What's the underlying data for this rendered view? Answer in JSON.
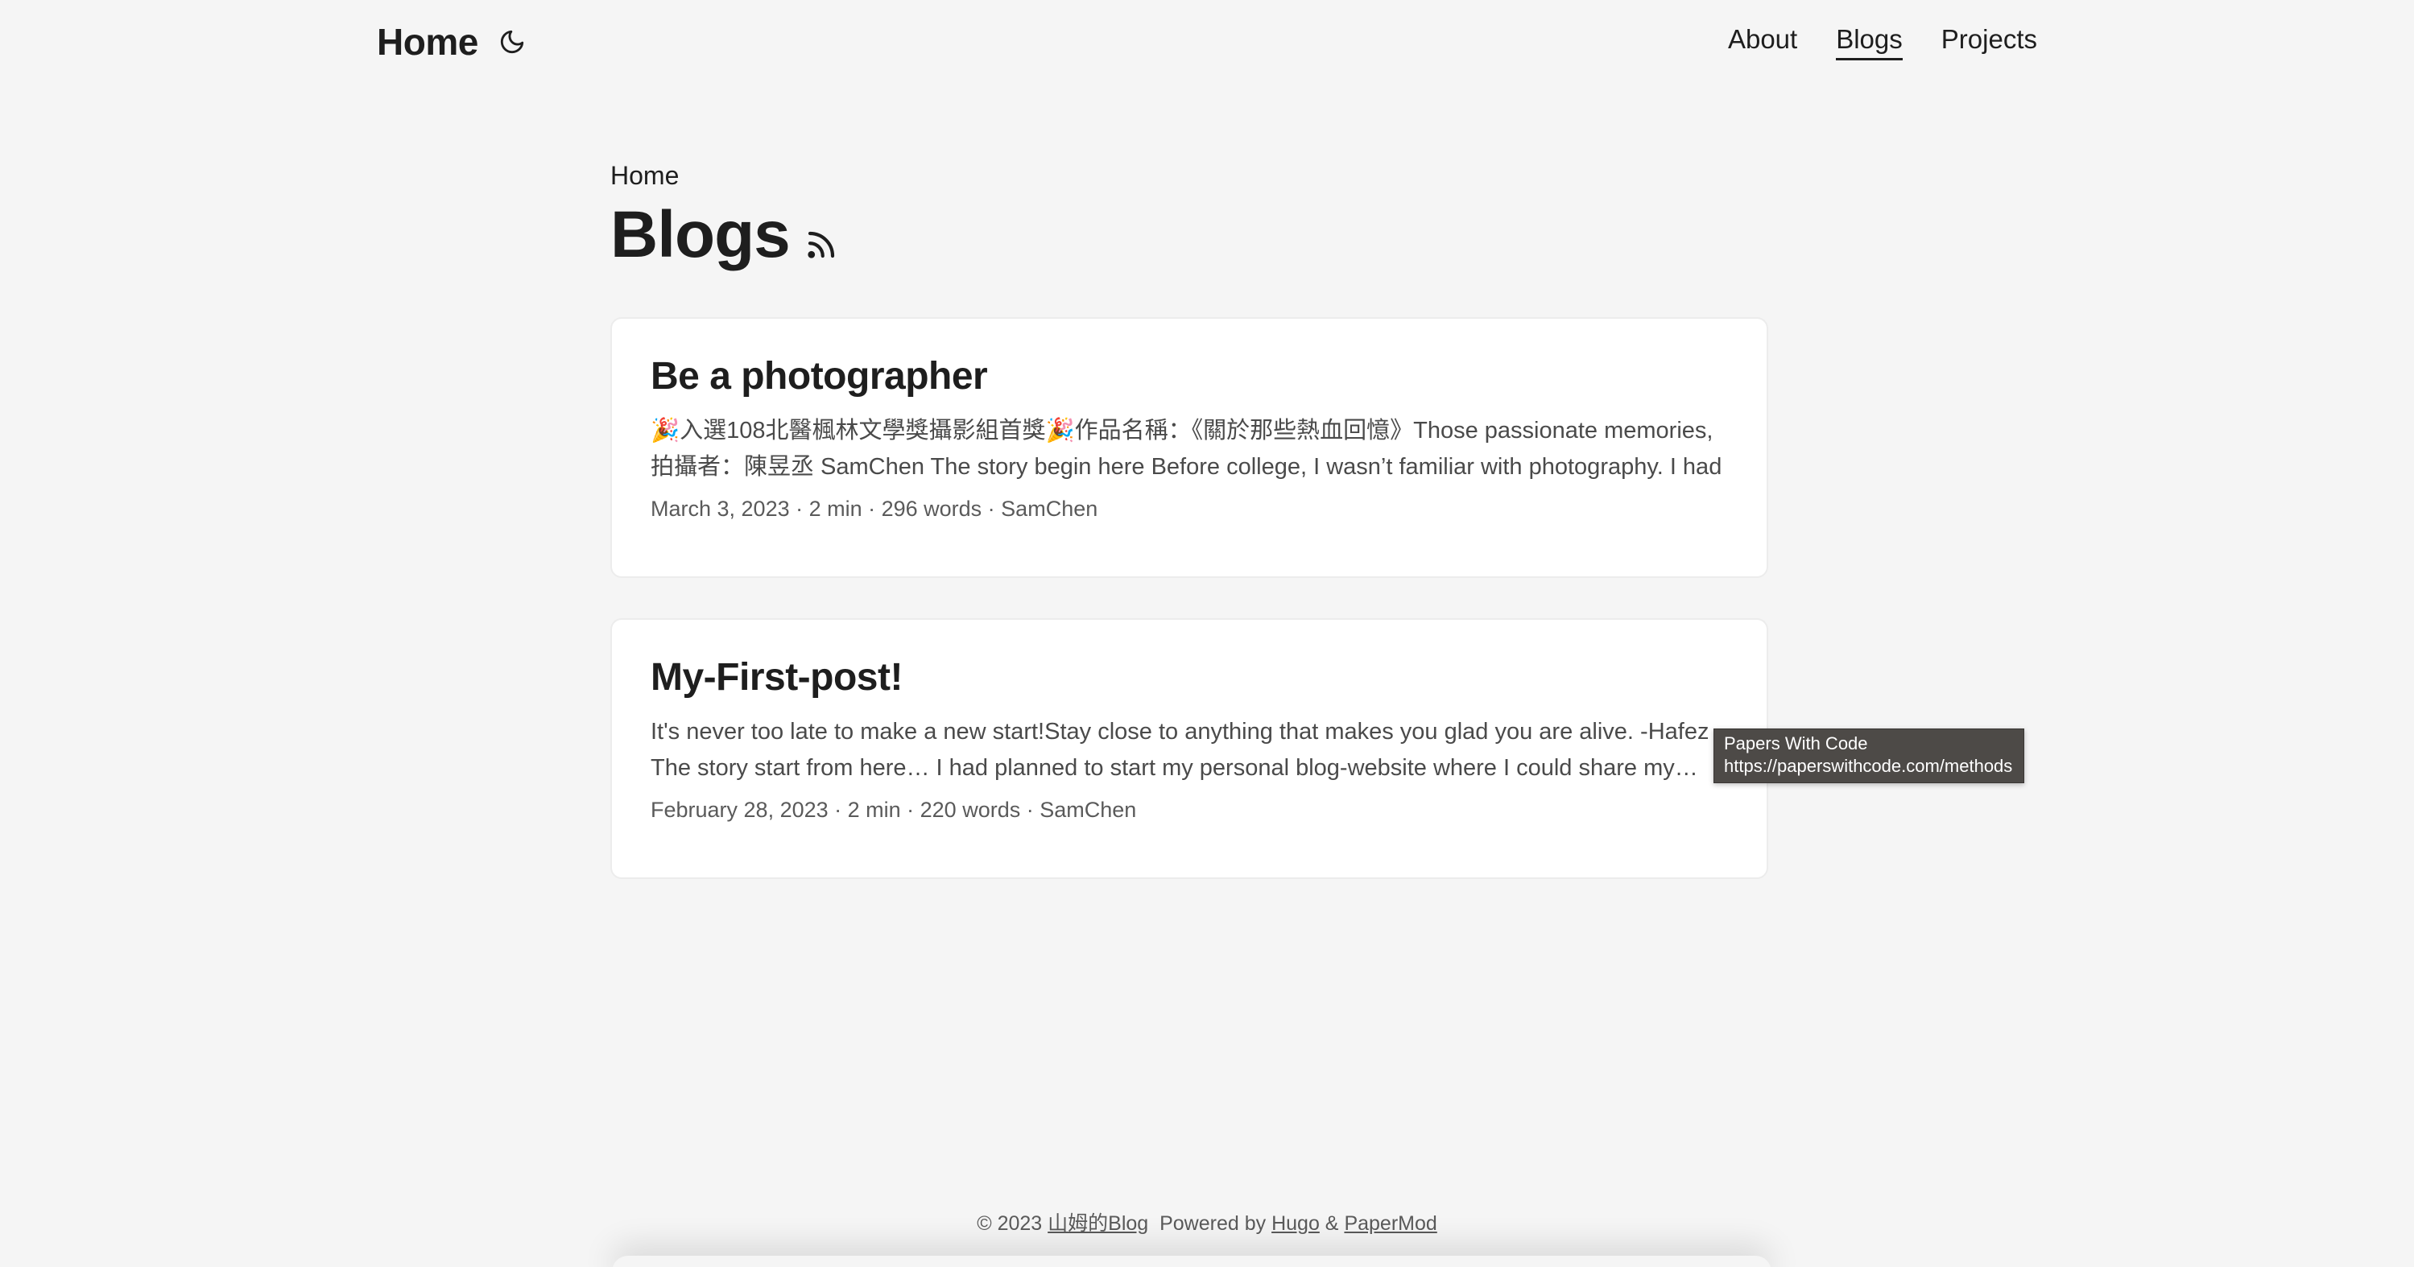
{
  "header": {
    "logo": "Home",
    "nav": [
      {
        "label": "About"
      },
      {
        "label": "Blogs",
        "active": true
      },
      {
        "label": "Projects"
      }
    ]
  },
  "main": {
    "breadcrumb": "Home",
    "title": "Blogs",
    "posts": [
      {
        "title": "Be a photographer",
        "summary": "🎉入選108北醫楓林文學獎攝影組首獎🎉作品名稱：《關於那些熱血回憶》Those passionate memories, 拍攝者：陳昱丞 SamChen The story begin here Before college, I wasn’t familiar with photography. I had ...",
        "meta": "March 3, 2023 · 2 min · 296 words · SamChen"
      },
      {
        "title": "My-First-post!",
        "summary": "It's never too late to make a new start!Stay close to anything that makes you glad you are alive. -Hafez The story start from here… I had planned to start my personal blog-website where I could share my…",
        "meta": "February 28, 2023 · 2 min · 220 words · SamChen"
      }
    ]
  },
  "tooltip": {
    "line1": "Papers With Code",
    "line2": "https://paperswithcode.com/methods"
  },
  "footer": {
    "copyright": "© 2023",
    "site_link": "山姆的Blog",
    "powered_by": "Powered by",
    "hugo": "Hugo",
    "amp": "&",
    "papermod": "PaperMod"
  },
  "icons": {
    "theme": "moon-icon",
    "rss": "rss-icon"
  }
}
